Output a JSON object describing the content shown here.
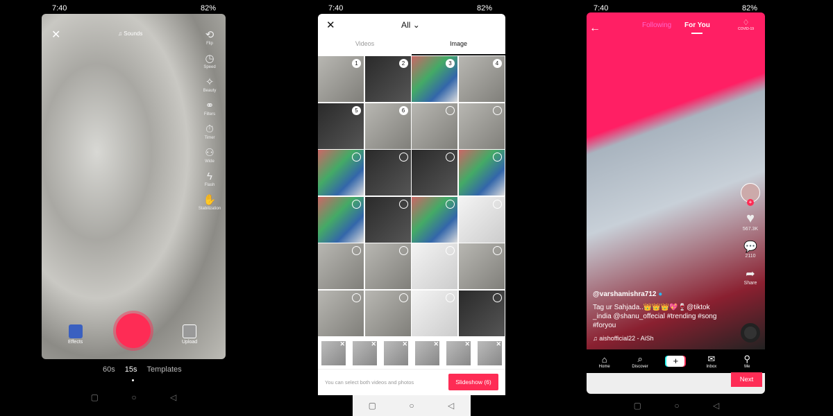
{
  "status": {
    "time": "7:40",
    "battery": "82%"
  },
  "camera": {
    "sounds": "Sounds",
    "tools": [
      {
        "icon": "flip-icon",
        "g": "⟲",
        "label": "Flip"
      },
      {
        "icon": "speed-icon",
        "g": "◷",
        "label": "Speed"
      },
      {
        "icon": "beauty-icon",
        "g": "✧",
        "label": "Beauty"
      },
      {
        "icon": "filters-icon",
        "g": "⚭",
        "label": "Filters"
      },
      {
        "icon": "timer-icon",
        "g": "⏱",
        "label": "Timer"
      },
      {
        "icon": "wide-icon",
        "g": "⚇",
        "label": "Wide"
      },
      {
        "icon": "flash-icon",
        "g": "ϟ",
        "label": "Flash"
      },
      {
        "icon": "stabilization-icon",
        "g": "✋",
        "label": "Stabilization"
      }
    ],
    "effects": "Effects",
    "upload": "Upload",
    "modes": [
      "60s",
      "15s",
      "Templates"
    ],
    "active_mode": "15s"
  },
  "gallery": {
    "filter": "All",
    "tabs": [
      "Videos",
      "Image"
    ],
    "active_tab": "Image",
    "cells": [
      {
        "s": "1",
        "t": ""
      },
      {
        "s": "2",
        "t": "dark"
      },
      {
        "s": "3",
        "t": "col"
      },
      {
        "s": "4",
        "t": ""
      },
      {
        "s": "5",
        "t": "dark"
      },
      {
        "s": "6",
        "t": ""
      },
      {
        "s": "",
        "t": ""
      },
      {
        "s": "",
        "t": ""
      },
      {
        "s": "",
        "t": "col"
      },
      {
        "s": "",
        "t": "dark"
      },
      {
        "s": "",
        "t": "dark"
      },
      {
        "s": "",
        "t": "col"
      },
      {
        "s": "",
        "t": "col"
      },
      {
        "s": "",
        "t": "dark"
      },
      {
        "s": "",
        "t": "col"
      },
      {
        "s": "",
        "t": "light"
      },
      {
        "s": "",
        "t": ""
      },
      {
        "s": "",
        "t": ""
      },
      {
        "s": "",
        "t": "light"
      },
      {
        "s": "",
        "t": ""
      },
      {
        "s": "",
        "t": ""
      },
      {
        "s": "",
        "t": ""
      },
      {
        "s": "",
        "t": "light"
      },
      {
        "s": "",
        "t": "dark"
      }
    ],
    "hint": "You can select both videos and photos",
    "slideshow": "Slideshow (6)"
  },
  "feed": {
    "tabs": [
      "Following",
      "For You"
    ],
    "active_tab": "For You",
    "covid": "COVID-19",
    "likes": "567.3K",
    "comments": "2110",
    "share": "Share",
    "username": "@varshamishra712",
    "caption": "Tag ur Sahjada..👑👑👑💖🍷@tiktok _india @shanu_offecial #trending #song #foryou",
    "sound": "aishofficial22 - AiSh",
    "nav": [
      "Home",
      "Discover",
      "",
      "Inbox",
      "Me"
    ],
    "next": "Next"
  },
  "colors": {
    "accent": "#fe2c55"
  }
}
